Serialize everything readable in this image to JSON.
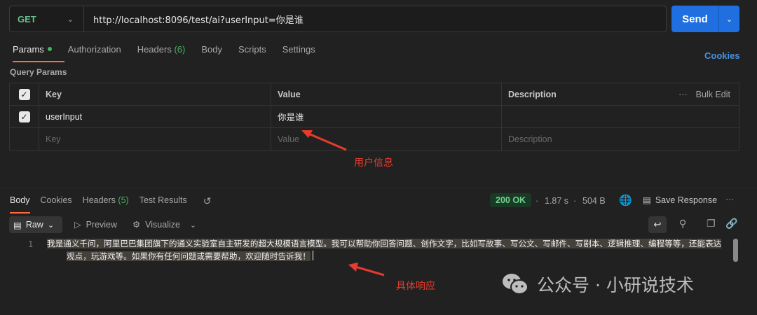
{
  "request": {
    "method": "GET",
    "url": "http://localhost:8096/test/ai?userInput=你是谁",
    "send_label": "Send"
  },
  "tabs": {
    "params": "Params",
    "authorization": "Authorization",
    "headers": "Headers",
    "headers_count": "(6)",
    "body": "Body",
    "scripts": "Scripts",
    "settings": "Settings",
    "cookies": "Cookies"
  },
  "query_params": {
    "label": "Query Params",
    "headers": {
      "key": "Key",
      "value": "Value",
      "description": "Description",
      "bulk_edit": "Bulk Edit"
    },
    "rows": [
      {
        "checked": true,
        "key": "userInput",
        "value": "你是谁",
        "description": ""
      }
    ],
    "placeholder": {
      "key": "Key",
      "value": "Value",
      "description": "Description"
    }
  },
  "annotations": {
    "user_info": "用户信息",
    "response_detail": "具体响应"
  },
  "response": {
    "tabs": {
      "body": "Body",
      "cookies": "Cookies",
      "headers": "Headers",
      "headers_count": "(5)",
      "test_results": "Test Results"
    },
    "status": "200 OK",
    "time": "1.87 s",
    "size": "504 B",
    "save_label": "Save Response",
    "format": "Raw",
    "preview": "Preview",
    "visualize": "Visualize",
    "line_number": "1",
    "body_line1": "我是通义千问，阿里巴巴集团旗下的通义实验室自主研发的超大规模语言模型。我可以帮助你回答问题、创作文字，比如写故事、写公文、写邮件、写剧本、逻辑推理、编程等等，还能表达",
    "body_line2": "观点，玩游戏等。如果你有任何问题或需要帮助，欢迎随时告诉我！"
  },
  "watermark": "公众号 · 小研说技术",
  "colors": {
    "method": "#63c28a",
    "send": "#1f6fe0",
    "accent": "#ff6c37",
    "status": "#6fd38d",
    "annotation": "#e63b2e",
    "link": "#4a90e2"
  }
}
